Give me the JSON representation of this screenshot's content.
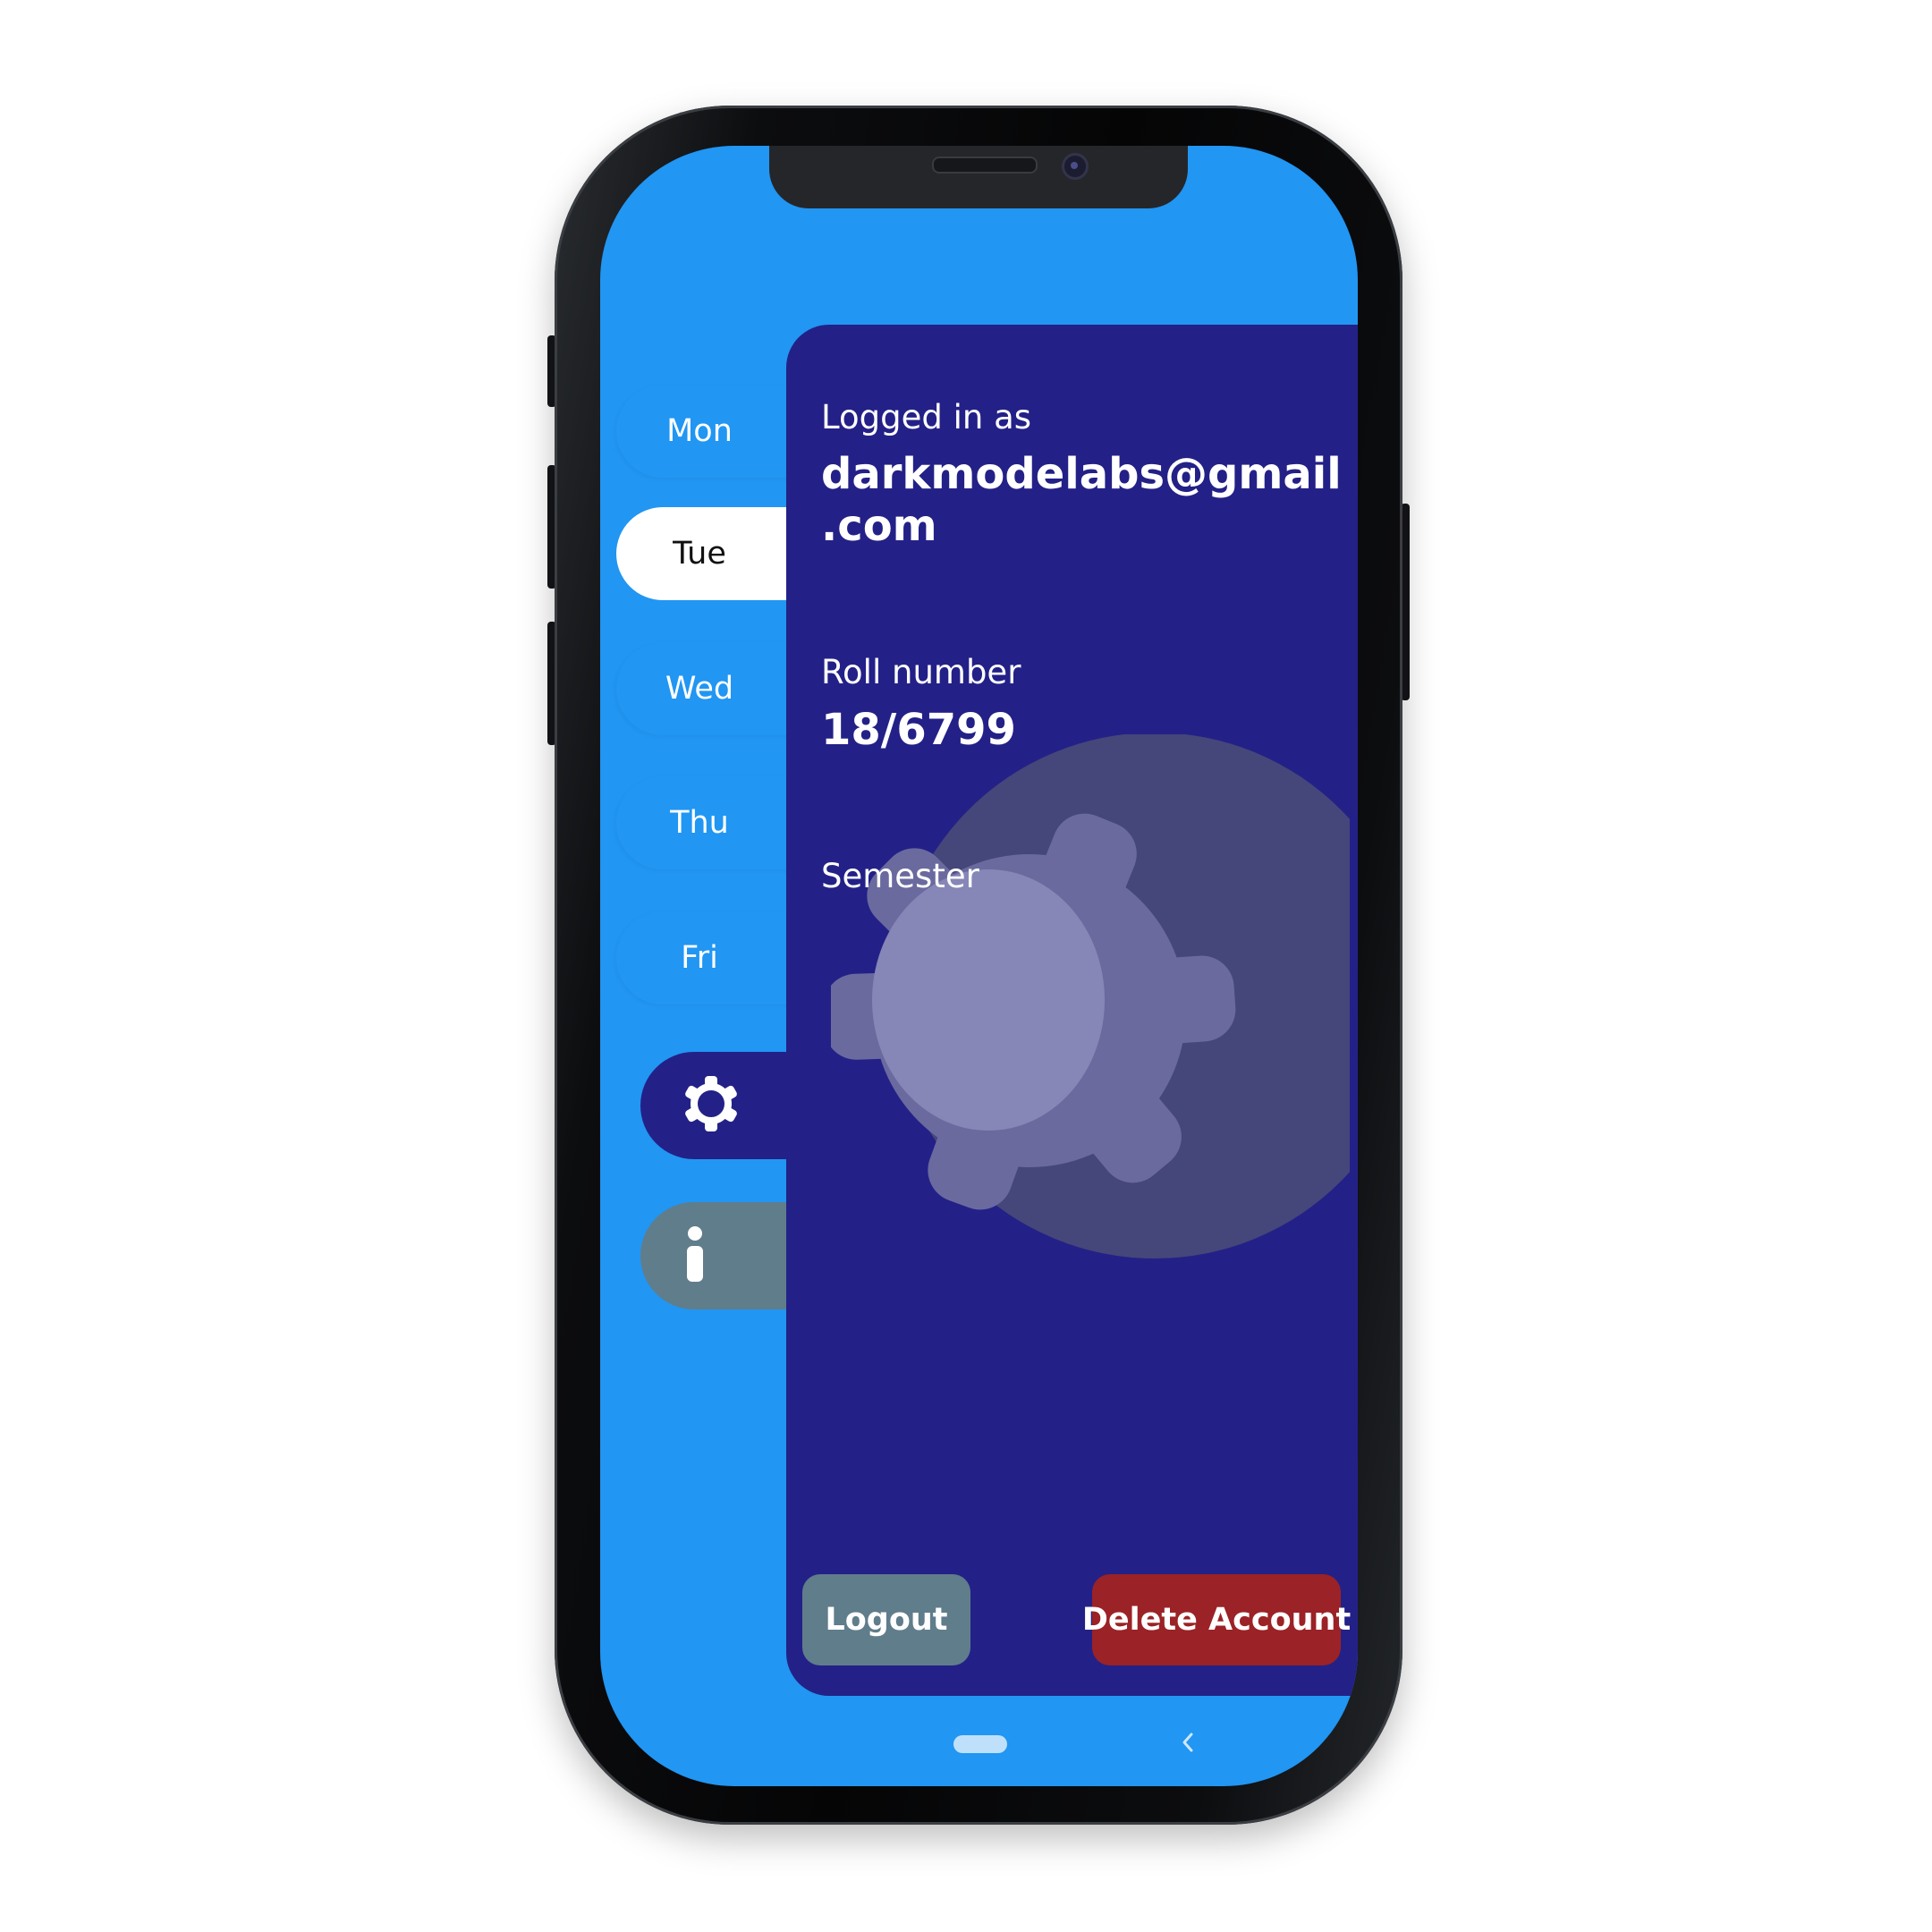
{
  "days": [
    {
      "label": "Mon",
      "active": false
    },
    {
      "label": "Tue",
      "active": true
    },
    {
      "label": "Wed",
      "active": false
    },
    {
      "label": "Thu",
      "active": false
    },
    {
      "label": "Fri",
      "active": false
    }
  ],
  "side_icons": {
    "settings": "gear-icon",
    "info": "info-icon"
  },
  "account": {
    "logged_in_label": "Logged in as",
    "email_line1": "darkmodelabs@gmail",
    "email_line2": ".com",
    "roll_label": "Roll number",
    "roll_value": "18/6799",
    "semester_label": "Semester"
  },
  "actions": {
    "logout_label": "Logout",
    "delete_label": "Delete Account"
  },
  "colors": {
    "screen_bg": "#2196f3",
    "panel_bg": "#232187",
    "info_tab": "#607d8b",
    "logout_button": "#607d8b",
    "delete_button": "#9b2226"
  }
}
